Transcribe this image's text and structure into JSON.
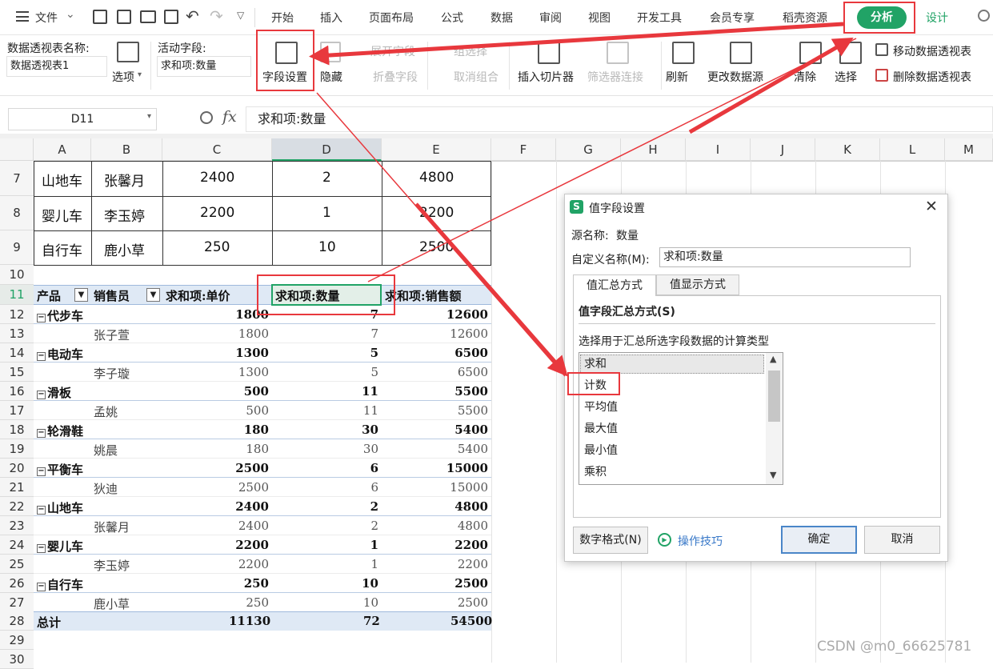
{
  "menubar": {
    "file_label": "文件",
    "tabs": [
      "开始",
      "插入",
      "页面布局",
      "公式",
      "数据",
      "审阅",
      "视图",
      "开发工具",
      "会员专享",
      "稻壳资源"
    ],
    "active_tab": "分析",
    "design_tab": "设计"
  },
  "ribbon": {
    "pivot_name_label": "数据透视表名称:",
    "pivot_name_value": "数据透视表1",
    "options_label": "选项",
    "active_field_label": "活动字段:",
    "active_field_value": "求和项:数量",
    "field_settings": "字段设置",
    "hide": "隐藏",
    "expand_field": "展开字段",
    "collapse_field": "折叠字段",
    "group_selection": "组选择",
    "ungroup": "取消组合",
    "insert_slicer": "插入切片器",
    "filter_connections": "筛选器连接",
    "refresh": "刷新",
    "change_source": "更改数据源",
    "clear": "清除",
    "select": "选择",
    "move_pivot": "移动数据透视表",
    "delete_pivot": "删除数据透视表"
  },
  "formula_bar": {
    "name_box": "D11",
    "fx": "fx",
    "content": "求和项:数量"
  },
  "columns": [
    "A",
    "B",
    "C",
    "D",
    "E",
    "F",
    "G",
    "H",
    "I",
    "J",
    "K",
    "L",
    "M"
  ],
  "source_rows": [
    {
      "row": "7",
      "product": "山地车",
      "seller": "张馨月",
      "price": "2400",
      "qty": "2",
      "amount": "4800"
    },
    {
      "row": "8",
      "product": "婴儿车",
      "seller": "李玉婷",
      "price": "2200",
      "qty": "1",
      "amount": "2200"
    },
    {
      "row": "9",
      "product": "自行车",
      "seller": "鹿小草",
      "price": "250",
      "qty": "10",
      "amount": "2500"
    }
  ],
  "row10": "10",
  "pivot_header": {
    "row": "11",
    "product": "产品",
    "seller": "销售员",
    "price": "求和项:单价",
    "qty": "求和项:数量",
    "amount": "求和项:销售额"
  },
  "pivot_rows": [
    {
      "row": "12",
      "label": "代步车",
      "price": "1800",
      "qty": "7",
      "amount": "12600",
      "group": true
    },
    {
      "row": "13",
      "label": "张子萱",
      "price": "1800",
      "qty": "7",
      "amount": "12600",
      "group": false
    },
    {
      "row": "14",
      "label": "电动车",
      "price": "1300",
      "qty": "5",
      "amount": "6500",
      "group": true
    },
    {
      "row": "15",
      "label": "李子璇",
      "price": "1300",
      "qty": "5",
      "amount": "6500",
      "group": false
    },
    {
      "row": "16",
      "label": "滑板",
      "price": "500",
      "qty": "11",
      "amount": "5500",
      "group": true
    },
    {
      "row": "17",
      "label": "孟姚",
      "price": "500",
      "qty": "11",
      "amount": "5500",
      "group": false
    },
    {
      "row": "18",
      "label": "轮滑鞋",
      "price": "180",
      "qty": "30",
      "amount": "5400",
      "group": true
    },
    {
      "row": "19",
      "label": "姚晨",
      "price": "180",
      "qty": "30",
      "amount": "5400",
      "group": false
    },
    {
      "row": "20",
      "label": "平衡车",
      "price": "2500",
      "qty": "6",
      "amount": "15000",
      "group": true
    },
    {
      "row": "21",
      "label": "狄迪",
      "price": "2500",
      "qty": "6",
      "amount": "15000",
      "group": false
    },
    {
      "row": "22",
      "label": "山地车",
      "price": "2400",
      "qty": "2",
      "amount": "4800",
      "group": true
    },
    {
      "row": "23",
      "label": "张馨月",
      "price": "2400",
      "qty": "2",
      "amount": "4800",
      "group": false
    },
    {
      "row": "24",
      "label": "婴儿车",
      "price": "2200",
      "qty": "1",
      "amount": "2200",
      "group": true
    },
    {
      "row": "25",
      "label": "李玉婷",
      "price": "2200",
      "qty": "1",
      "amount": "2200",
      "group": false
    },
    {
      "row": "26",
      "label": "自行车",
      "price": "250",
      "qty": "10",
      "amount": "2500",
      "group": true
    },
    {
      "row": "27",
      "label": "鹿小草",
      "price": "250",
      "qty": "10",
      "amount": "2500",
      "group": false
    }
  ],
  "total_row": {
    "row": "28",
    "label": "总计",
    "price": "11130",
    "qty": "72",
    "amount": "54500"
  },
  "extra_rows": [
    "29",
    "30"
  ],
  "dialog": {
    "title": "值字段设置",
    "source_label": "源名称:",
    "source_value": "数量",
    "custom_label": "自定义名称(M):",
    "custom_value": "求和项:数量",
    "tab_summary": "值汇总方式",
    "tab_show": "值显示方式",
    "section_title": "值字段汇总方式(S)",
    "instruction": "选择用于汇总所选字段数据的计算类型",
    "options": [
      "求和",
      "计数",
      "平均值",
      "最大值",
      "最小值",
      "乘积"
    ],
    "selected": "求和",
    "number_format": "数字格式(N)",
    "tips": "操作技巧",
    "ok": "确定",
    "cancel": "取消"
  },
  "watermark": "CSDN @m0_66625781",
  "colors": {
    "accent": "#21a366",
    "highlight": "#e8383d"
  }
}
